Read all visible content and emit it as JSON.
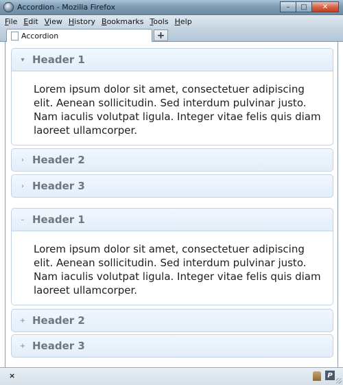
{
  "window": {
    "title": "Accordion - Mozilla Firefox",
    "controls": {
      "minimize": "–",
      "maximize": "□",
      "close": "✕"
    }
  },
  "menubar": [
    {
      "label": "File",
      "accel": "F",
      "rest": "ile"
    },
    {
      "label": "Edit",
      "accel": "E",
      "rest": "dit"
    },
    {
      "label": "View",
      "accel": "V",
      "rest": "iew"
    },
    {
      "label": "History",
      "accel": "H",
      "rest": "istory"
    },
    {
      "label": "Bookmarks",
      "accel": "B",
      "rest": "ookmarks"
    },
    {
      "label": "Tools",
      "accel": "T",
      "rest": "ools"
    },
    {
      "label": "Help",
      "accel": "H",
      "rest": "elp"
    }
  ],
  "tabs": {
    "active_tab_label": "Accordion",
    "new_tab_symbol": "+"
  },
  "accordion_1": {
    "icons": {
      "expanded": "▾",
      "collapsed": "›"
    },
    "sections": [
      {
        "title": "Header 1",
        "expanded": true,
        "content": "Lorem ipsum dolor sit amet, consectetuer adipiscing elit. Aenean sollicitudin. Sed interdum pulvinar justo. Nam iaculis volutpat ligula. Integer vitae felis quis diam laoreet ullamcorper."
      },
      {
        "title": "Header 2",
        "expanded": false
      },
      {
        "title": "Header 3",
        "expanded": false
      }
    ]
  },
  "accordion_2": {
    "icons": {
      "expanded": "–",
      "collapsed": "+"
    },
    "sections": [
      {
        "title": "Header 1",
        "expanded": true,
        "content": "Lorem ipsum dolor sit amet, consectetuer adipiscing elit. Aenean sollicitudin. Sed interdum pulvinar justo. Nam iaculis volutpat ligula. Integer vitae felis quis diam laoreet ullamcorper."
      },
      {
        "title": "Header 2",
        "expanded": false
      },
      {
        "title": "Header 3",
        "expanded": false
      }
    ]
  },
  "statusbar": {
    "close_symbol": "×",
    "addon_icon": "puzzle-icon",
    "extension_icon": "p-icon",
    "extension_letter": "P"
  },
  "colors": {
    "header_gradient_top": "#f1f7fd",
    "header_gradient_bottom": "#e2eefa",
    "header_border": "#c3d3e3",
    "header_text": "#6e7780"
  }
}
